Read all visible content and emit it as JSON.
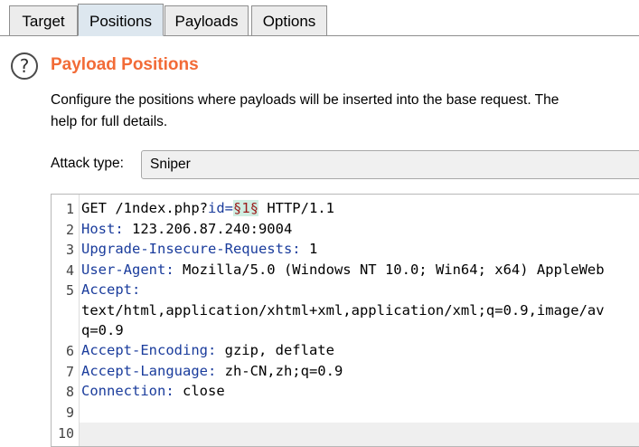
{
  "tabs": [
    "Target",
    "Positions",
    "Payloads",
    "Options"
  ],
  "section": {
    "help_glyph": "?",
    "title": "Payload Positions",
    "desc_line1": "Configure the positions where payloads will be inserted into the base request. The",
    "desc_line2": "help for full details."
  },
  "attack": {
    "label": "Attack type:",
    "value": "Sniper"
  },
  "editor": {
    "line_numbers": [
      "1",
      "2",
      "3",
      "4",
      "5",
      "",
      "",
      "6",
      "7",
      "8",
      "9",
      "10"
    ],
    "l1_pre": "GET /1ndex.php?",
    "l1_param": "id=",
    "l1_marker": "§1§",
    "l1_post": " HTTP/1.1",
    "l2_key": "Host:",
    "l2_val": " 123.206.87.240:9004",
    "l3_key": "Upgrade-Insecure-Requests:",
    "l3_val": " 1",
    "l4_key": "User-Agent:",
    "l4_val": " Mozilla/5.0 (Windows NT 10.0; Win64; x64) AppleWeb",
    "l5_key": "Accept:",
    "l5_cont1": "text/html,application/xhtml+xml,application/xml;q=0.9,image/av",
    "l5_cont2": "q=0.9",
    "l6_key": "Accept-Encoding:",
    "l6_val": " gzip, deflate",
    "l7_key": "Accept-Language:",
    "l7_val": " zh-CN,zh;q=0.9",
    "l8_key": "Connection:",
    "l8_val": " close"
  }
}
